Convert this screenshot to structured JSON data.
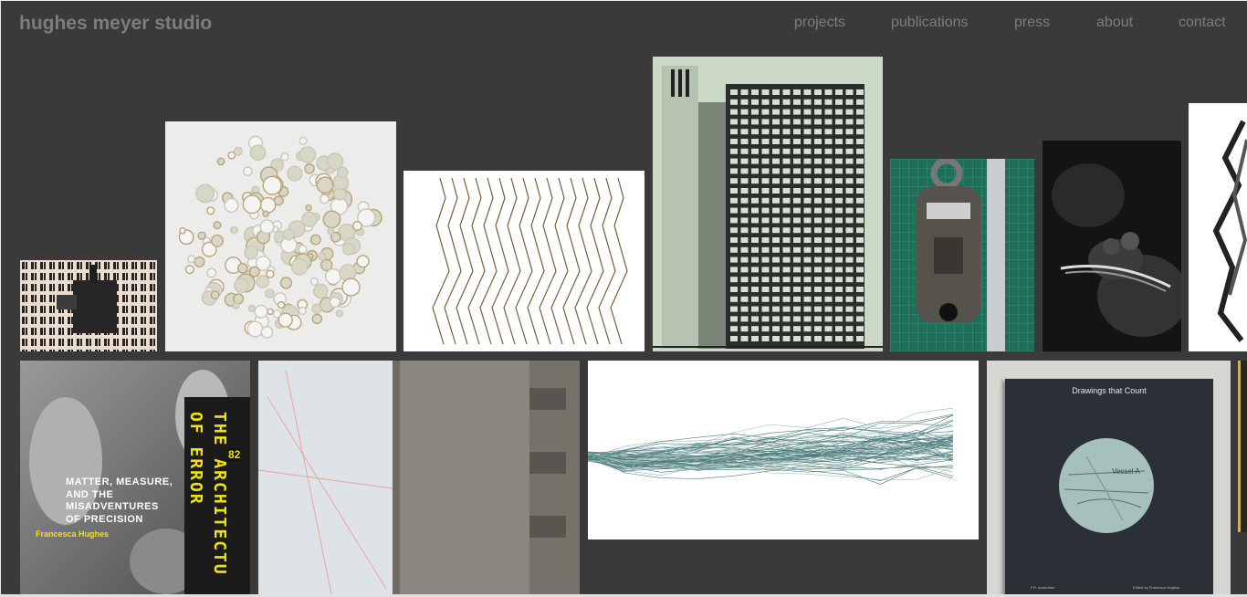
{
  "site": {
    "brand": "hughes meyer studio"
  },
  "nav": {
    "projects": "projects",
    "publications": "publications",
    "press": "press",
    "about": "about",
    "contact": "contact"
  },
  "book1": {
    "title_line1": "MATTER, MEASURE,",
    "title_line2": "AND THE",
    "title_line3": "MISADVENTURES",
    "title_line4": "OF PRECISION",
    "author": "Francesca Hughes",
    "spine_line1": "THE ARCHITECTU",
    "spine_line2": "OF ERROR",
    "spine_number": "82"
  },
  "book2": {
    "title": "Drawings that Count",
    "disc_label": "Vessel A",
    "footer_left": "F.R. Anstruther",
    "footer_right": "Edited by Francesca Hughes"
  },
  "colors": {
    "background": "#3a3a3a",
    "text_muted": "#7d7d7d",
    "book_yellow": "#f2e400"
  }
}
